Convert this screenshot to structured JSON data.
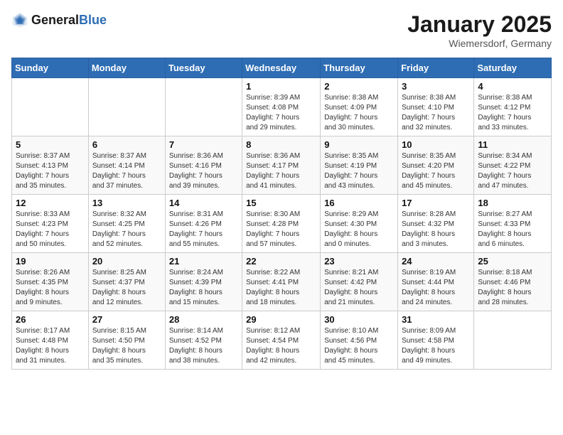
{
  "logo": {
    "text_general": "General",
    "text_blue": "Blue"
  },
  "header": {
    "month_year": "January 2025",
    "location": "Wiemersdorf, Germany"
  },
  "days_of_week": [
    "Sunday",
    "Monday",
    "Tuesday",
    "Wednesday",
    "Thursday",
    "Friday",
    "Saturday"
  ],
  "weeks": [
    [
      {
        "day": "",
        "info": ""
      },
      {
        "day": "",
        "info": ""
      },
      {
        "day": "",
        "info": ""
      },
      {
        "day": "1",
        "info": "Sunrise: 8:39 AM\nSunset: 4:08 PM\nDaylight: 7 hours\nand 29 minutes."
      },
      {
        "day": "2",
        "info": "Sunrise: 8:38 AM\nSunset: 4:09 PM\nDaylight: 7 hours\nand 30 minutes."
      },
      {
        "day": "3",
        "info": "Sunrise: 8:38 AM\nSunset: 4:10 PM\nDaylight: 7 hours\nand 32 minutes."
      },
      {
        "day": "4",
        "info": "Sunrise: 8:38 AM\nSunset: 4:12 PM\nDaylight: 7 hours\nand 33 minutes."
      }
    ],
    [
      {
        "day": "5",
        "info": "Sunrise: 8:37 AM\nSunset: 4:13 PM\nDaylight: 7 hours\nand 35 minutes."
      },
      {
        "day": "6",
        "info": "Sunrise: 8:37 AM\nSunset: 4:14 PM\nDaylight: 7 hours\nand 37 minutes."
      },
      {
        "day": "7",
        "info": "Sunrise: 8:36 AM\nSunset: 4:16 PM\nDaylight: 7 hours\nand 39 minutes."
      },
      {
        "day": "8",
        "info": "Sunrise: 8:36 AM\nSunset: 4:17 PM\nDaylight: 7 hours\nand 41 minutes."
      },
      {
        "day": "9",
        "info": "Sunrise: 8:35 AM\nSunset: 4:19 PM\nDaylight: 7 hours\nand 43 minutes."
      },
      {
        "day": "10",
        "info": "Sunrise: 8:35 AM\nSunset: 4:20 PM\nDaylight: 7 hours\nand 45 minutes."
      },
      {
        "day": "11",
        "info": "Sunrise: 8:34 AM\nSunset: 4:22 PM\nDaylight: 7 hours\nand 47 minutes."
      }
    ],
    [
      {
        "day": "12",
        "info": "Sunrise: 8:33 AM\nSunset: 4:23 PM\nDaylight: 7 hours\nand 50 minutes."
      },
      {
        "day": "13",
        "info": "Sunrise: 8:32 AM\nSunset: 4:25 PM\nDaylight: 7 hours\nand 52 minutes."
      },
      {
        "day": "14",
        "info": "Sunrise: 8:31 AM\nSunset: 4:26 PM\nDaylight: 7 hours\nand 55 minutes."
      },
      {
        "day": "15",
        "info": "Sunrise: 8:30 AM\nSunset: 4:28 PM\nDaylight: 7 hours\nand 57 minutes."
      },
      {
        "day": "16",
        "info": "Sunrise: 8:29 AM\nSunset: 4:30 PM\nDaylight: 8 hours\nand 0 minutes."
      },
      {
        "day": "17",
        "info": "Sunrise: 8:28 AM\nSunset: 4:32 PM\nDaylight: 8 hours\nand 3 minutes."
      },
      {
        "day": "18",
        "info": "Sunrise: 8:27 AM\nSunset: 4:33 PM\nDaylight: 8 hours\nand 6 minutes."
      }
    ],
    [
      {
        "day": "19",
        "info": "Sunrise: 8:26 AM\nSunset: 4:35 PM\nDaylight: 8 hours\nand 9 minutes."
      },
      {
        "day": "20",
        "info": "Sunrise: 8:25 AM\nSunset: 4:37 PM\nDaylight: 8 hours\nand 12 minutes."
      },
      {
        "day": "21",
        "info": "Sunrise: 8:24 AM\nSunset: 4:39 PM\nDaylight: 8 hours\nand 15 minutes."
      },
      {
        "day": "22",
        "info": "Sunrise: 8:22 AM\nSunset: 4:41 PM\nDaylight: 8 hours\nand 18 minutes."
      },
      {
        "day": "23",
        "info": "Sunrise: 8:21 AM\nSunset: 4:42 PM\nDaylight: 8 hours\nand 21 minutes."
      },
      {
        "day": "24",
        "info": "Sunrise: 8:19 AM\nSunset: 4:44 PM\nDaylight: 8 hours\nand 24 minutes."
      },
      {
        "day": "25",
        "info": "Sunrise: 8:18 AM\nSunset: 4:46 PM\nDaylight: 8 hours\nand 28 minutes."
      }
    ],
    [
      {
        "day": "26",
        "info": "Sunrise: 8:17 AM\nSunset: 4:48 PM\nDaylight: 8 hours\nand 31 minutes."
      },
      {
        "day": "27",
        "info": "Sunrise: 8:15 AM\nSunset: 4:50 PM\nDaylight: 8 hours\nand 35 minutes."
      },
      {
        "day": "28",
        "info": "Sunrise: 8:14 AM\nSunset: 4:52 PM\nDaylight: 8 hours\nand 38 minutes."
      },
      {
        "day": "29",
        "info": "Sunrise: 8:12 AM\nSunset: 4:54 PM\nDaylight: 8 hours\nand 42 minutes."
      },
      {
        "day": "30",
        "info": "Sunrise: 8:10 AM\nSunset: 4:56 PM\nDaylight: 8 hours\nand 45 minutes."
      },
      {
        "day": "31",
        "info": "Sunrise: 8:09 AM\nSunset: 4:58 PM\nDaylight: 8 hours\nand 49 minutes."
      },
      {
        "day": "",
        "info": ""
      }
    ]
  ]
}
